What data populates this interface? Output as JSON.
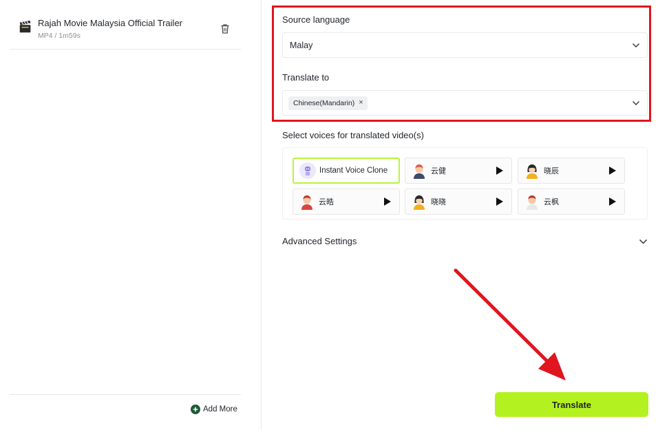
{
  "file": {
    "title": "Rajah Movie Malaysia Official Trailer",
    "meta": "MP4 / 1m59s",
    "icon": "clapperboard-icon"
  },
  "add_more_label": "Add More",
  "source_language": {
    "label": "Source language",
    "value": "Malay"
  },
  "translate_to": {
    "label": "Translate to",
    "chips": [
      "Chinese(Mandarin)"
    ],
    "remove_glyph": "×"
  },
  "voices": {
    "label": "Select voices for translated video(s)",
    "items": [
      {
        "name": "Instant Voice Clone",
        "selected": true,
        "avatar": "robot-avatar-icon"
      },
      {
        "name": "云健",
        "selected": false,
        "avatar": "male-avatar-icon"
      },
      {
        "name": "晓辰",
        "selected": false,
        "avatar": "female-avatar-icon"
      },
      {
        "name": "云皓",
        "selected": false,
        "avatar": "male-avatar-icon"
      },
      {
        "name": "晓晓",
        "selected": false,
        "avatar": "female-avatar-icon"
      },
      {
        "name": "云枫",
        "selected": false,
        "avatar": "male-avatar-icon"
      }
    ]
  },
  "advanced_settings_label": "Advanced Settings",
  "translate_button_label": "Translate",
  "colors": {
    "accent": "#b4f120",
    "highlight": "#e0151f",
    "selected_border": "#b8f53a"
  }
}
